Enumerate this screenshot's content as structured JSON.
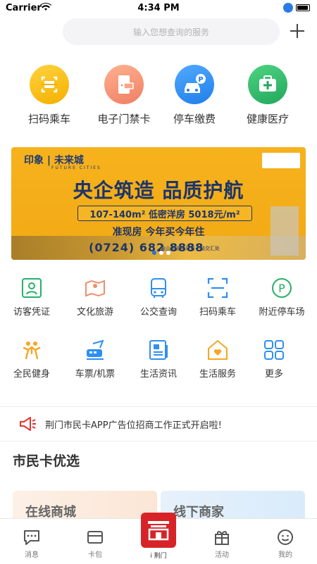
{
  "status": {
    "carrier": "Carrier",
    "time": "4:34 PM"
  },
  "search": {
    "placeholder": "输入您想查询的服务"
  },
  "top_services": [
    {
      "label": "扫码乘车",
      "icon": "qr-scan-icon",
      "color": "#f5b80b"
    },
    {
      "label": "电子门禁卡",
      "icon": "door-card-icon",
      "color": "#f28a6e"
    },
    {
      "label": "停车缴费",
      "icon": "parking-car-icon",
      "color": "#2e8ef3"
    },
    {
      "label": "健康医疗",
      "icon": "medical-kit-icon",
      "color": "#32b96c"
    }
  ],
  "banner": {
    "brand": "印象 | 未来城",
    "brand_sub": "FUTURE CITIES",
    "headline": "央企筑造 品质护航",
    "price_line": "107-140m² 低密洋房 5018元/m²",
    "subline": "准现房 今年买今年住",
    "phone": "(0724) 682 8888",
    "address": "象山大道与双喜一路交汇处",
    "dots": 3,
    "active_dot": 0
  },
  "grid": [
    {
      "label": "访客凭证",
      "icon": "visitor-pass-icon"
    },
    {
      "label": "文化旅游",
      "icon": "map-location-icon"
    },
    {
      "label": "公交查询",
      "icon": "bus-icon"
    },
    {
      "label": "扫码乘车",
      "icon": "scan-frame-icon"
    },
    {
      "label": "附近停车场",
      "icon": "parking-p-icon"
    },
    {
      "label": "全民健身",
      "icon": "fitness-icon"
    },
    {
      "label": "车票/机票",
      "icon": "train-plane-icon"
    },
    {
      "label": "生活资讯",
      "icon": "news-icon"
    },
    {
      "label": "生活服务",
      "icon": "home-heart-icon"
    },
    {
      "label": "更多",
      "icon": "grid-more-icon"
    }
  ],
  "notice": {
    "text": "荆门市民卡APP广告位招商工作正式开启啦!"
  },
  "section": {
    "title": "市民卡优选"
  },
  "cards": [
    {
      "title": "在线商城"
    },
    {
      "title": "线下商家"
    }
  ],
  "tabbar": [
    {
      "label": "消息",
      "icon": "message-icon"
    },
    {
      "label": "卡包",
      "icon": "wallet-icon"
    },
    {
      "label": "i 荆门",
      "icon": "jingmen-logo-icon"
    },
    {
      "label": "活动",
      "icon": "gift-icon"
    },
    {
      "label": "我的",
      "icon": "smile-profile-icon"
    }
  ]
}
